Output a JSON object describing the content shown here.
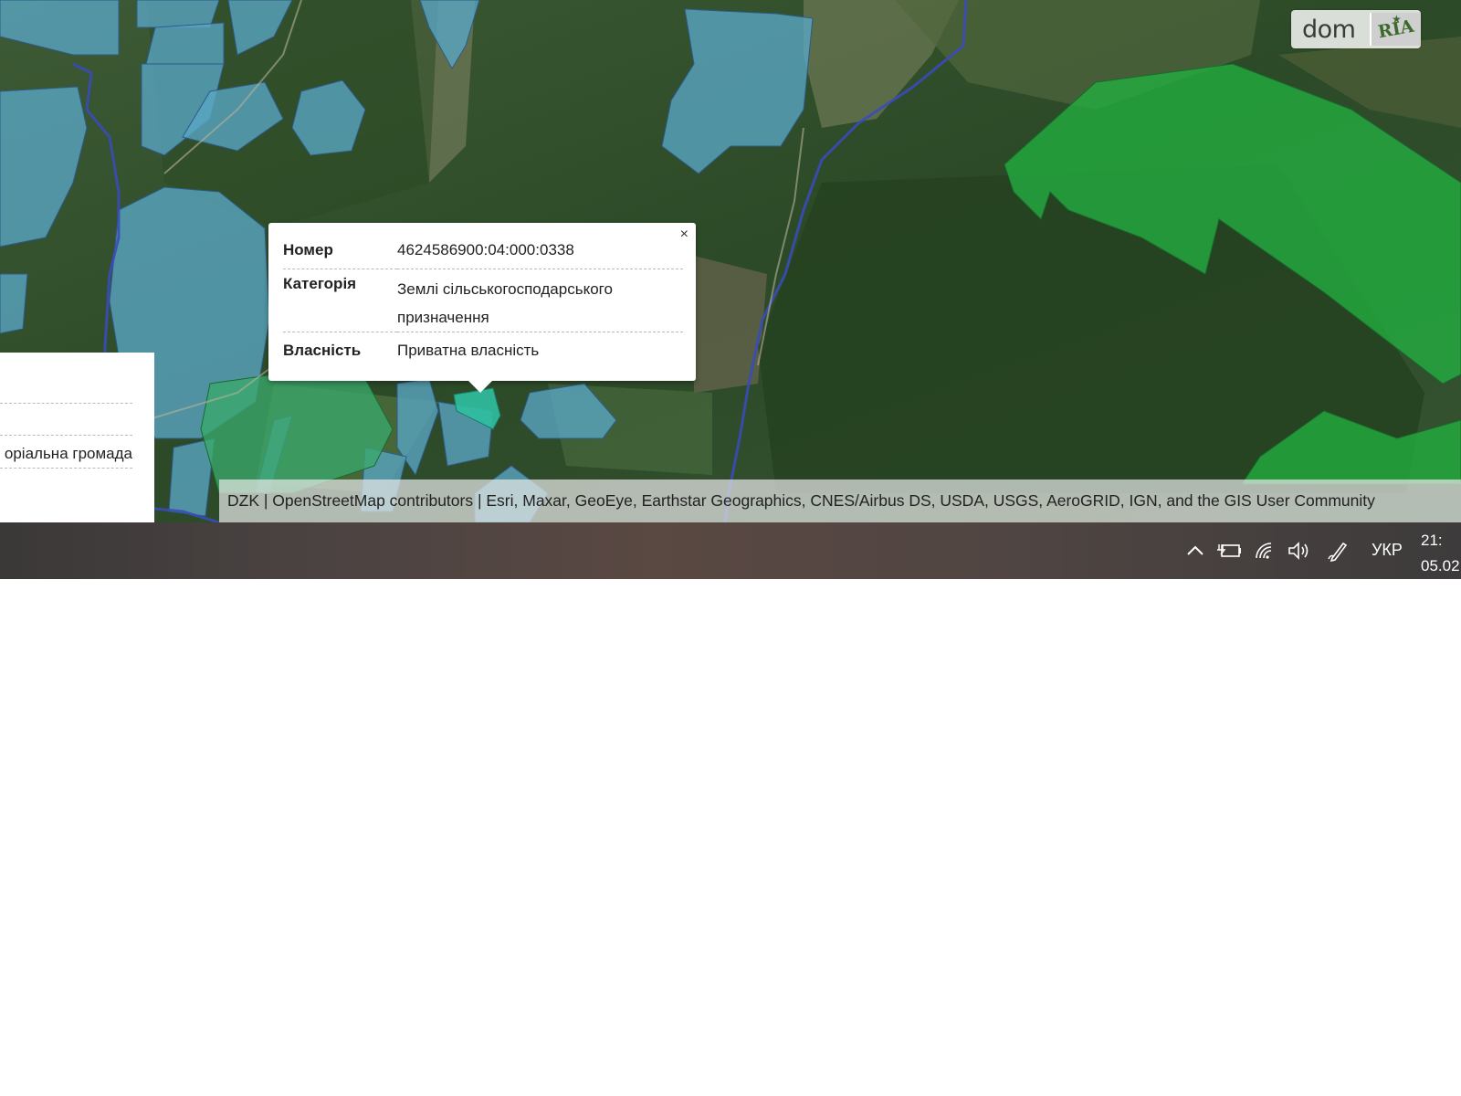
{
  "brand": {
    "logo_dom": "dom",
    "logo_ria": "RIA"
  },
  "popup": {
    "close_label": "×",
    "rows": [
      {
        "key": "Номер",
        "value": "4624586900:04:000:0338"
      },
      {
        "key": "Категорія",
        "value": "Землі сільськогосподарського призначення"
      },
      {
        "key": "Власність",
        "value": "Приватна власність"
      }
    ]
  },
  "left_panel": {
    "partial_text": "оріальна громада"
  },
  "map": {
    "attribution": "DZK | OpenStreetMap contributors | Esri, Maxar, GeoEye, Earthstar Geographics, CNES/Airbus DS, USDA, USGS, AeroGRID, IGN, and the GIS User Community",
    "colors": {
      "agri_parcel": "#5aa6c4",
      "forest_parcel": "#1fa83a",
      "selected_parcel": "#2fbfa0",
      "boundary": "#3b4bb8"
    }
  },
  "taskbar": {
    "icons": [
      "chevron-up-icon",
      "battery-charging-icon",
      "wifi-icon",
      "speaker-icon",
      "pen-icon"
    ],
    "language": "УКР",
    "time": "21:",
    "date": "05.02"
  }
}
